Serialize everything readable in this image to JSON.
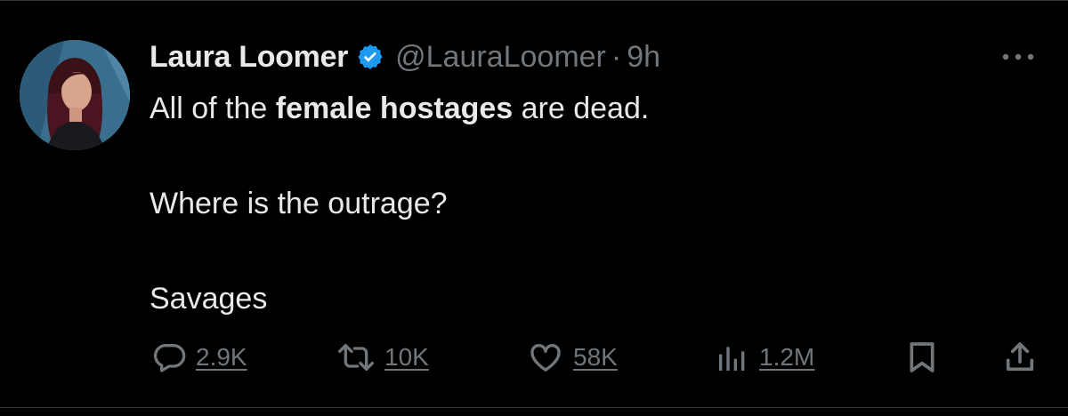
{
  "tweet": {
    "author": {
      "display_name": "Laura Loomer",
      "handle": "@LauraLoomer",
      "verified": true,
      "avatar_icon": "profile-photo"
    },
    "separator": "·",
    "time": "9h",
    "text": {
      "line1_prefix": "All of the ",
      "line1_bold": "female hostages",
      "line1_suffix": " are dead.",
      "line2": "Where is the outrage?",
      "line3": "Savages"
    },
    "metrics": {
      "replies": "2.9K",
      "reposts": "10K",
      "likes": "58K",
      "views": "1.2M"
    }
  },
  "icons": {
    "more": "more-horizontal-icon",
    "reply": "reply-icon",
    "repost": "repost-icon",
    "like": "heart-icon",
    "views": "views-icon",
    "bookmark": "bookmark-icon",
    "share": "share-icon"
  },
  "colors": {
    "background": "#000000",
    "text_primary": "#e7e9ea",
    "text_secondary": "#71767b",
    "verified_blue": "#1d9bf0",
    "border": "#2f3336"
  }
}
